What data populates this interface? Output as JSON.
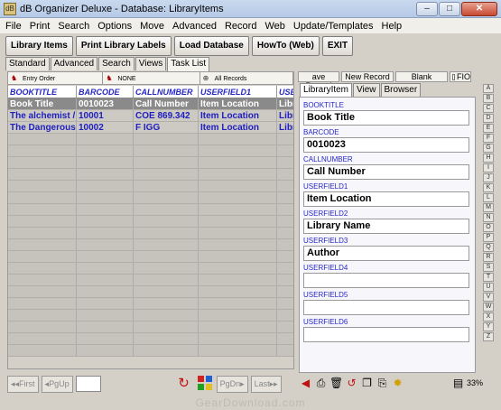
{
  "window": {
    "title": "dB Organizer Deluxe - Database: LibraryItems",
    "minimize": "–",
    "maximize": "□",
    "close": "✕"
  },
  "menu": [
    "File",
    "Print",
    "Search",
    "Options",
    "Move",
    "Advanced",
    "Record",
    "Web",
    "Update/Templates",
    "Help"
  ],
  "toolbar": [
    "Library Items",
    "Print Library Labels",
    "Load Database",
    "HowTo (Web)",
    "EXIT"
  ],
  "view_tabs": [
    "Standard",
    "Advanced",
    "Search",
    "Views",
    "Task List"
  ],
  "sort": {
    "order": "Entry Order",
    "filter": "NONE",
    "records": "All Records"
  },
  "grid": {
    "columns": [
      "BOOKTITLE",
      "BARCODE",
      "CALLNUMBER",
      "USERFIELD1",
      "USE"
    ],
    "rows": [
      [
        "Book Title",
        "0010023",
        "Call Number",
        "Item Location",
        "Libr"
      ],
      [
        "The alchemist / S",
        "10001",
        "COE 869.342",
        "Item Location",
        "Libr"
      ],
      [
        "The Dangerous E",
        "10002",
        "F IGG",
        "Item Location",
        "Libr"
      ]
    ]
  },
  "record_buttons": [
    "ave Record",
    "New Record",
    "Blank",
    "FIO"
  ],
  "right_tabs": [
    "LibraryItem",
    "View",
    "Browser"
  ],
  "fields": [
    {
      "label": "BOOKTITLE",
      "value": "Book Title"
    },
    {
      "label": "BARCODE",
      "value": "0010023"
    },
    {
      "label": "CALLNUMBER",
      "value": "Call Number"
    },
    {
      "label": "USERFIELD1",
      "value": "Item Location"
    },
    {
      "label": "USERFIELD2",
      "value": "Library Name"
    },
    {
      "label": "USERFIELD3",
      "value": "Author"
    },
    {
      "label": "USERFIELD4",
      "value": ""
    },
    {
      "label": "USERFIELD5",
      "value": ""
    },
    {
      "label": "USERFIELD6",
      "value": ""
    }
  ],
  "alphabet": [
    "A",
    "B",
    "C",
    "D",
    "E",
    "F",
    "G",
    "H",
    "I",
    "J",
    "K",
    "L",
    "M",
    "N",
    "O",
    "P",
    "Q",
    "R",
    "S",
    "T",
    "U",
    "V",
    "W",
    "X",
    "Y",
    "Z"
  ],
  "nav": {
    "first": "First",
    "pgup": "PgUp",
    "pgdn": "PgDn",
    "last": "Last"
  },
  "zoom": "33%",
  "watermark": "GearDownload.com"
}
